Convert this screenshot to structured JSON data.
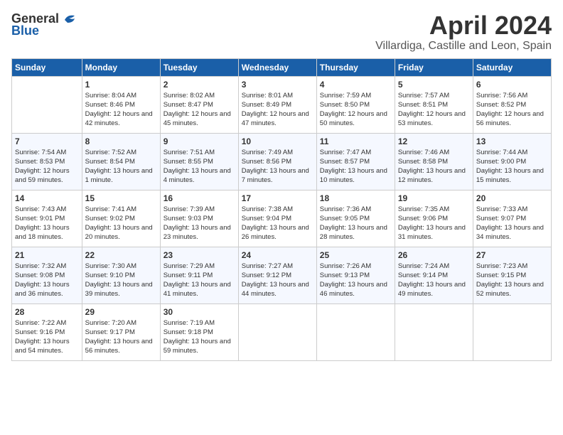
{
  "header": {
    "logo_general": "General",
    "logo_blue": "Blue",
    "title": "April 2024",
    "subtitle": "Villardiga, Castille and Leon, Spain"
  },
  "weekdays": [
    "Sunday",
    "Monday",
    "Tuesday",
    "Wednesday",
    "Thursday",
    "Friday",
    "Saturday"
  ],
  "weeks": [
    [
      {
        "day": "",
        "sunrise": "",
        "sunset": "",
        "daylight": ""
      },
      {
        "day": "1",
        "sunrise": "Sunrise: 8:04 AM",
        "sunset": "Sunset: 8:46 PM",
        "daylight": "Daylight: 12 hours and 42 minutes."
      },
      {
        "day": "2",
        "sunrise": "Sunrise: 8:02 AM",
        "sunset": "Sunset: 8:47 PM",
        "daylight": "Daylight: 12 hours and 45 minutes."
      },
      {
        "day": "3",
        "sunrise": "Sunrise: 8:01 AM",
        "sunset": "Sunset: 8:49 PM",
        "daylight": "Daylight: 12 hours and 47 minutes."
      },
      {
        "day": "4",
        "sunrise": "Sunrise: 7:59 AM",
        "sunset": "Sunset: 8:50 PM",
        "daylight": "Daylight: 12 hours and 50 minutes."
      },
      {
        "day": "5",
        "sunrise": "Sunrise: 7:57 AM",
        "sunset": "Sunset: 8:51 PM",
        "daylight": "Daylight: 12 hours and 53 minutes."
      },
      {
        "day": "6",
        "sunrise": "Sunrise: 7:56 AM",
        "sunset": "Sunset: 8:52 PM",
        "daylight": "Daylight: 12 hours and 56 minutes."
      }
    ],
    [
      {
        "day": "7",
        "sunrise": "Sunrise: 7:54 AM",
        "sunset": "Sunset: 8:53 PM",
        "daylight": "Daylight: 12 hours and 59 minutes."
      },
      {
        "day": "8",
        "sunrise": "Sunrise: 7:52 AM",
        "sunset": "Sunset: 8:54 PM",
        "daylight": "Daylight: 13 hours and 1 minute."
      },
      {
        "day": "9",
        "sunrise": "Sunrise: 7:51 AM",
        "sunset": "Sunset: 8:55 PM",
        "daylight": "Daylight: 13 hours and 4 minutes."
      },
      {
        "day": "10",
        "sunrise": "Sunrise: 7:49 AM",
        "sunset": "Sunset: 8:56 PM",
        "daylight": "Daylight: 13 hours and 7 minutes."
      },
      {
        "day": "11",
        "sunrise": "Sunrise: 7:47 AM",
        "sunset": "Sunset: 8:57 PM",
        "daylight": "Daylight: 13 hours and 10 minutes."
      },
      {
        "day": "12",
        "sunrise": "Sunrise: 7:46 AM",
        "sunset": "Sunset: 8:58 PM",
        "daylight": "Daylight: 13 hours and 12 minutes."
      },
      {
        "day": "13",
        "sunrise": "Sunrise: 7:44 AM",
        "sunset": "Sunset: 9:00 PM",
        "daylight": "Daylight: 13 hours and 15 minutes."
      }
    ],
    [
      {
        "day": "14",
        "sunrise": "Sunrise: 7:43 AM",
        "sunset": "Sunset: 9:01 PM",
        "daylight": "Daylight: 13 hours and 18 minutes."
      },
      {
        "day": "15",
        "sunrise": "Sunrise: 7:41 AM",
        "sunset": "Sunset: 9:02 PM",
        "daylight": "Daylight: 13 hours and 20 minutes."
      },
      {
        "day": "16",
        "sunrise": "Sunrise: 7:39 AM",
        "sunset": "Sunset: 9:03 PM",
        "daylight": "Daylight: 13 hours and 23 minutes."
      },
      {
        "day": "17",
        "sunrise": "Sunrise: 7:38 AM",
        "sunset": "Sunset: 9:04 PM",
        "daylight": "Daylight: 13 hours and 26 minutes."
      },
      {
        "day": "18",
        "sunrise": "Sunrise: 7:36 AM",
        "sunset": "Sunset: 9:05 PM",
        "daylight": "Daylight: 13 hours and 28 minutes."
      },
      {
        "day": "19",
        "sunrise": "Sunrise: 7:35 AM",
        "sunset": "Sunset: 9:06 PM",
        "daylight": "Daylight: 13 hours and 31 minutes."
      },
      {
        "day": "20",
        "sunrise": "Sunrise: 7:33 AM",
        "sunset": "Sunset: 9:07 PM",
        "daylight": "Daylight: 13 hours and 34 minutes."
      }
    ],
    [
      {
        "day": "21",
        "sunrise": "Sunrise: 7:32 AM",
        "sunset": "Sunset: 9:08 PM",
        "daylight": "Daylight: 13 hours and 36 minutes."
      },
      {
        "day": "22",
        "sunrise": "Sunrise: 7:30 AM",
        "sunset": "Sunset: 9:10 PM",
        "daylight": "Daylight: 13 hours and 39 minutes."
      },
      {
        "day": "23",
        "sunrise": "Sunrise: 7:29 AM",
        "sunset": "Sunset: 9:11 PM",
        "daylight": "Daylight: 13 hours and 41 minutes."
      },
      {
        "day": "24",
        "sunrise": "Sunrise: 7:27 AM",
        "sunset": "Sunset: 9:12 PM",
        "daylight": "Daylight: 13 hours and 44 minutes."
      },
      {
        "day": "25",
        "sunrise": "Sunrise: 7:26 AM",
        "sunset": "Sunset: 9:13 PM",
        "daylight": "Daylight: 13 hours and 46 minutes."
      },
      {
        "day": "26",
        "sunrise": "Sunrise: 7:24 AM",
        "sunset": "Sunset: 9:14 PM",
        "daylight": "Daylight: 13 hours and 49 minutes."
      },
      {
        "day": "27",
        "sunrise": "Sunrise: 7:23 AM",
        "sunset": "Sunset: 9:15 PM",
        "daylight": "Daylight: 13 hours and 52 minutes."
      }
    ],
    [
      {
        "day": "28",
        "sunrise": "Sunrise: 7:22 AM",
        "sunset": "Sunset: 9:16 PM",
        "daylight": "Daylight: 13 hours and 54 minutes."
      },
      {
        "day": "29",
        "sunrise": "Sunrise: 7:20 AM",
        "sunset": "Sunset: 9:17 PM",
        "daylight": "Daylight: 13 hours and 56 minutes."
      },
      {
        "day": "30",
        "sunrise": "Sunrise: 7:19 AM",
        "sunset": "Sunset: 9:18 PM",
        "daylight": "Daylight: 13 hours and 59 minutes."
      },
      {
        "day": "",
        "sunrise": "",
        "sunset": "",
        "daylight": ""
      },
      {
        "day": "",
        "sunrise": "",
        "sunset": "",
        "daylight": ""
      },
      {
        "day": "",
        "sunrise": "",
        "sunset": "",
        "daylight": ""
      },
      {
        "day": "",
        "sunrise": "",
        "sunset": "",
        "daylight": ""
      }
    ]
  ]
}
